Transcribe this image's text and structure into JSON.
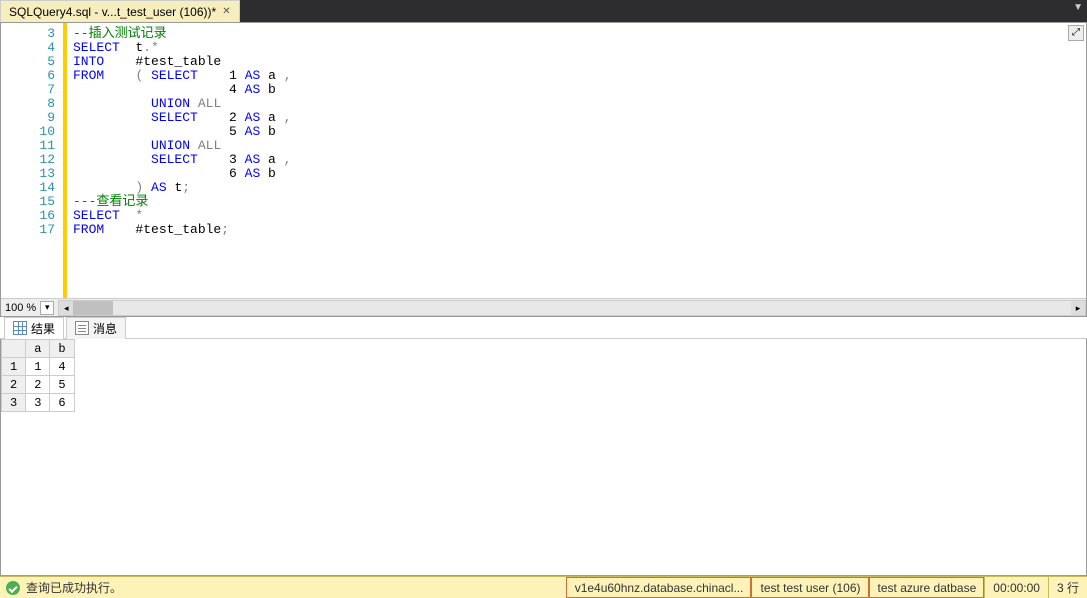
{
  "tab": {
    "title": "SQLQuery4.sql - v...t_test_user (106))*"
  },
  "editor": {
    "line_start": 3,
    "lines": [
      {
        "n": 3,
        "tokens": [
          [
            "cm",
            "--插入测试记录"
          ]
        ]
      },
      {
        "n": 4,
        "tokens": [
          [
            "kw",
            "SELECT"
          ],
          [
            "",
            "  t"
          ],
          [
            "gr",
            "."
          ],
          [
            "gr",
            "*"
          ]
        ]
      },
      {
        "n": 5,
        "tokens": [
          [
            "kw",
            "INTO"
          ],
          [
            "",
            "    #test_table"
          ]
        ]
      },
      {
        "n": 6,
        "tokens": [
          [
            "kw",
            "FROM"
          ],
          [
            "",
            "    "
          ],
          [
            "gr",
            "("
          ],
          [
            "",
            " "
          ],
          [
            "kw",
            "SELECT"
          ],
          [
            "",
            "    1 "
          ],
          [
            "kw",
            "AS"
          ],
          [
            "",
            " a "
          ],
          [
            "gr",
            ","
          ]
        ]
      },
      {
        "n": 7,
        "tokens": [
          [
            "",
            "                    4 "
          ],
          [
            "kw",
            "AS"
          ],
          [
            "",
            " b"
          ]
        ]
      },
      {
        "n": 8,
        "tokens": [
          [
            "",
            "          "
          ],
          [
            "kw",
            "UNION"
          ],
          [
            "",
            " "
          ],
          [
            "gr",
            "ALL"
          ]
        ]
      },
      {
        "n": 9,
        "tokens": [
          [
            "",
            "          "
          ],
          [
            "kw",
            "SELECT"
          ],
          [
            "",
            "    2 "
          ],
          [
            "kw",
            "AS"
          ],
          [
            "",
            " a "
          ],
          [
            "gr",
            ","
          ]
        ]
      },
      {
        "n": 10,
        "tokens": [
          [
            "",
            "                    5 "
          ],
          [
            "kw",
            "AS"
          ],
          [
            "",
            " b"
          ]
        ]
      },
      {
        "n": 11,
        "tokens": [
          [
            "",
            "          "
          ],
          [
            "kw",
            "UNION"
          ],
          [
            "",
            " "
          ],
          [
            "gr",
            "ALL"
          ]
        ]
      },
      {
        "n": 12,
        "tokens": [
          [
            "",
            "          "
          ],
          [
            "kw",
            "SELECT"
          ],
          [
            "",
            "    3 "
          ],
          [
            "kw",
            "AS"
          ],
          [
            "",
            " a "
          ],
          [
            "gr",
            ","
          ]
        ]
      },
      {
        "n": 13,
        "tokens": [
          [
            "",
            "                    6 "
          ],
          [
            "kw",
            "AS"
          ],
          [
            "",
            " b"
          ]
        ]
      },
      {
        "n": 14,
        "tokens": [
          [
            "",
            "        "
          ],
          [
            "gr",
            ")"
          ],
          [
            "",
            " "
          ],
          [
            "kw",
            "AS"
          ],
          [
            "",
            " t"
          ],
          [
            "gr",
            ";"
          ]
        ]
      },
      {
        "n": 15,
        "tokens": [
          [
            "cm",
            "---查看记录"
          ]
        ]
      },
      {
        "n": 16,
        "tokens": [
          [
            "kw",
            "SELECT"
          ],
          [
            "",
            "  "
          ],
          [
            "gr",
            "*"
          ]
        ]
      },
      {
        "n": 17,
        "tokens": [
          [
            "kw",
            "FROM"
          ],
          [
            "",
            "    #test_table"
          ],
          [
            "gr",
            ";"
          ]
        ]
      }
    ],
    "zoom": "100 %"
  },
  "results": {
    "tabs": {
      "results": "结果",
      "messages": "消息"
    },
    "columns": [
      "",
      "a",
      "b"
    ],
    "rows": [
      [
        "1",
        "1",
        "4"
      ],
      [
        "2",
        "2",
        "5"
      ],
      [
        "3",
        "3",
        "6"
      ]
    ]
  },
  "status": {
    "message": "查询已成功执行。",
    "server": "v1e4u60hnz.database.chinacl...",
    "user": "test test user (106)",
    "database": "test azure datbase",
    "elapsed": "00:00:00",
    "rows": "3 行"
  }
}
